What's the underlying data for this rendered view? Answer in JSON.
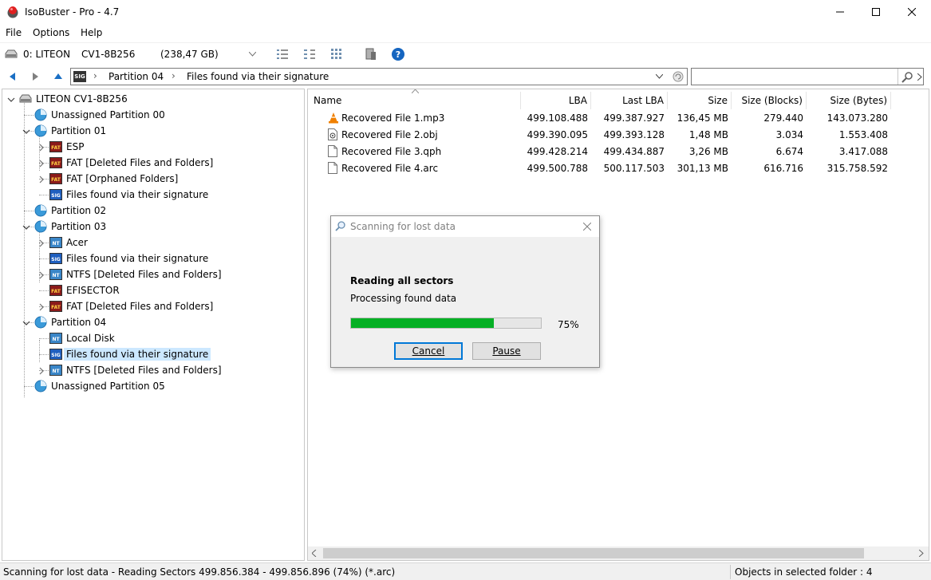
{
  "window": {
    "title": "IsoBuster - Pro - 4.7"
  },
  "menu": {
    "items": [
      {
        "label": "File"
      },
      {
        "label": "Options"
      },
      {
        "label": "Help"
      }
    ]
  },
  "toolbar": {
    "drive_label": "0: LITEON",
    "drive_model": "CV1-8B256",
    "drive_size": "(238,47 GB)"
  },
  "navbar": {
    "path_badge": "SIG",
    "path": [
      "Partition 04",
      "Files found via their signature"
    ]
  },
  "tree": {
    "items": [
      {
        "label": "LITEON CV1-8B256",
        "icon": "drive-icon"
      },
      {
        "label": "Unassigned Partition 00",
        "icon": "partition-icon"
      },
      {
        "label": "Partition 01",
        "icon": "partition-icon"
      },
      {
        "label": "ESP",
        "icon": "fat-icon",
        "badge": "FAT"
      },
      {
        "label": "FAT [Deleted Files and Folders]",
        "icon": "fat-icon",
        "badge": "FAT"
      },
      {
        "label": "FAT [Orphaned Folders]",
        "icon": "fat-icon",
        "badge": "FAT"
      },
      {
        "label": "Files found via their signature",
        "icon": "sig-icon",
        "badge": "SIG"
      },
      {
        "label": "Partition 02",
        "icon": "partition-icon"
      },
      {
        "label": "Partition 03",
        "icon": "partition-icon"
      },
      {
        "label": "Acer",
        "icon": "ntfs-icon",
        "badge": "NT"
      },
      {
        "label": "Files found via their signature",
        "icon": "sig-icon",
        "badge": "SIG"
      },
      {
        "label": "NTFS [Deleted Files and Folders]",
        "icon": "ntfs-icon",
        "badge": "NT"
      },
      {
        "label": "EFISECTOR",
        "icon": "fat-icon",
        "badge": "FAT"
      },
      {
        "label": "FAT [Deleted Files and Folders]",
        "icon": "fat-icon",
        "badge": "FAT"
      },
      {
        "label": "Partition 04",
        "icon": "partition-icon"
      },
      {
        "label": "Local Disk",
        "icon": "ntfs-icon",
        "badge": "NT"
      },
      {
        "label": "Files found via their signature",
        "icon": "sig-icon",
        "badge": "SIG"
      },
      {
        "label": "NTFS [Deleted Files and Folders]",
        "icon": "ntfs-icon",
        "badge": "NT"
      },
      {
        "label": "Unassigned Partition 05",
        "icon": "partition-icon"
      }
    ]
  },
  "list": {
    "columns": [
      "Name",
      "LBA",
      "Last LBA",
      "Size",
      "Size (Blocks)",
      "Size (Bytes)"
    ],
    "rows": [
      {
        "name": "Recovered File 1.mp3",
        "lba": "499.108.488",
        "last_lba": "499.387.927",
        "size": "136,45 MB",
        "blocks": "279.440",
        "bytes": "143.073.280",
        "icon": "vlc-icon"
      },
      {
        "name": "Recovered File 2.obj",
        "lba": "499.390.095",
        "last_lba": "499.393.128",
        "size": "1,48 MB",
        "blocks": "3.034",
        "bytes": "1.553.408",
        "icon": "object-file-icon"
      },
      {
        "name": "Recovered File 3.qph",
        "lba": "499.428.214",
        "last_lba": "499.434.887",
        "size": "3,26 MB",
        "blocks": "6.674",
        "bytes": "3.417.088",
        "icon": "file-icon"
      },
      {
        "name": "Recovered File 4.arc",
        "lba": "499.500.788",
        "last_lba": "500.117.503",
        "size": "301,13 MB",
        "blocks": "616.716",
        "bytes": "315.758.592",
        "icon": "file-icon"
      }
    ]
  },
  "dialog": {
    "title": "Scanning for lost data",
    "heading": "Reading all sectors",
    "subtext": "Processing found data",
    "progress": 0.75,
    "progress_label": "75%",
    "cancel_label": "Cancel",
    "pause_label": "Pause"
  },
  "status": {
    "left": "Scanning for lost data - Reading Sectors 499.856.384 - 499.856.896    (74%) (*.arc)",
    "right": "Objects in selected folder : 4"
  },
  "colors": {
    "progress_green": "#06b025",
    "selection": "#cce8ff",
    "accent_blue": "#0078d7"
  }
}
